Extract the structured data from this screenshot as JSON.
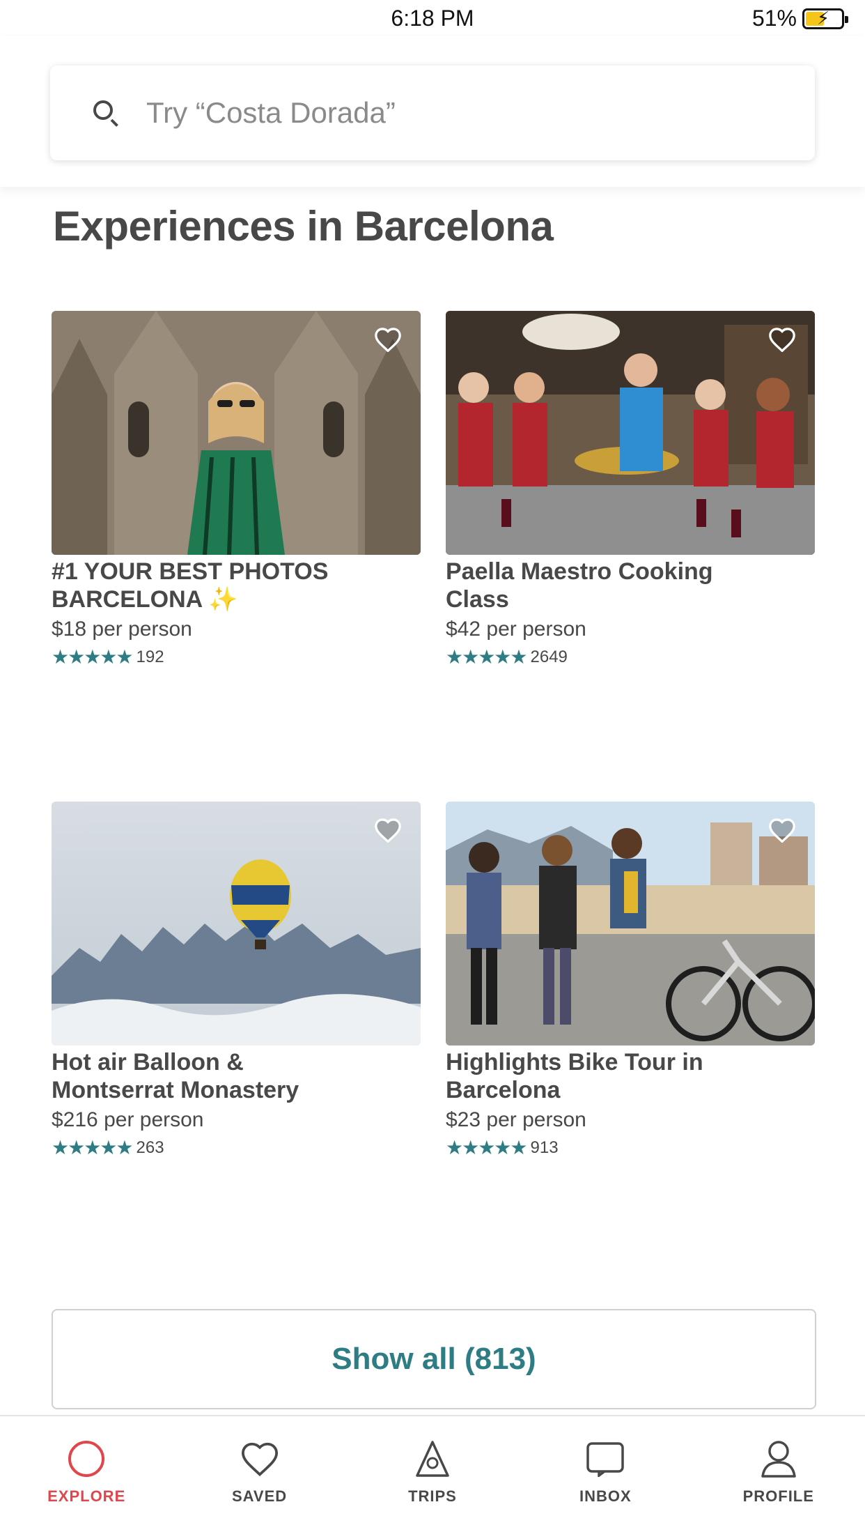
{
  "status_bar": {
    "time": "6:18 PM",
    "battery": "51%",
    "battery_level": 0.51
  },
  "search": {
    "placeholder": "Try “Costa Dorada”",
    "value": ""
  },
  "section": {
    "title": "Experiences in Barcelona"
  },
  "cards": [
    {
      "kicker": "",
      "title": "#1 YOUR BEST PHOTOS BARCELONA ✨",
      "price": "$18 per person",
      "rating": 5,
      "stars": "★★★★★",
      "reviews": "192",
      "image": "woman-before-cathedral"
    },
    {
      "kicker": "",
      "title": "Paella Maestro Cooking Class",
      "price": "$42 per person",
      "rating": 5,
      "stars": "★★★★★",
      "reviews": "2649",
      "image": "paella-cooking-class"
    },
    {
      "kicker": "",
      "title": "Hot air Balloon & Montserrat Monastery",
      "price": "$216 per person",
      "rating": 5,
      "stars": "★★★★★",
      "reviews": "263",
      "image": "hot-air-balloon-mountains"
    },
    {
      "kicker": "",
      "title": "Highlights Bike Tour in Barcelona",
      "price": "$23 per person",
      "rating": 5,
      "stars": "★★★★★",
      "reviews": "913",
      "image": "bike-tour-beach"
    }
  ],
  "show_all": {
    "label": "Show all (813)"
  },
  "tabs": [
    {
      "label": "EXPLORE",
      "icon": "explore-icon",
      "active": true
    },
    {
      "label": "SAVED",
      "icon": "heart-icon",
      "active": false
    },
    {
      "label": "TRIPS",
      "icon": "trips-icon",
      "active": false
    },
    {
      "label": "INBOX",
      "icon": "inbox-icon",
      "active": false
    },
    {
      "label": "PROFILE",
      "icon": "profile-icon",
      "active": false
    }
  ],
  "colors": {
    "accent": "#2e7d84",
    "brand": "#e0474c",
    "text": "#484848"
  }
}
